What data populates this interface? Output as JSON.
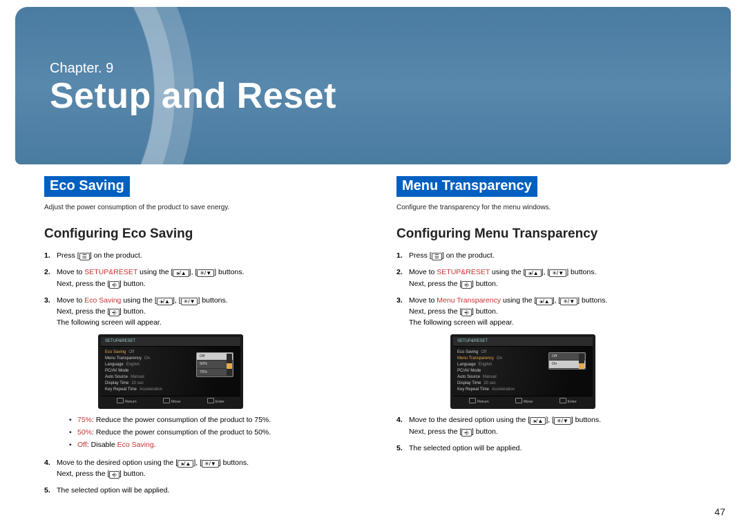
{
  "header": {
    "chapter_label": "Chapter. 9",
    "title": "Setup and Reset"
  },
  "page_number": "47",
  "icons": {
    "menu": "☰",
    "vol_up": "🕩/▲",
    "vol_dn": "✳/▼",
    "enter": "⎆"
  },
  "left": {
    "tag": "Eco Saving",
    "desc": "Adjust the power consumption of the product to save energy.",
    "subheading": "Configuring Eco Saving",
    "steps": {
      "s1_a": "Press [",
      "s1_b": "] on the product.",
      "s2_a": "Move to ",
      "s2_target": "SETUP&RESET",
      "s2_b": " using the [",
      "s2_c": "], [",
      "s2_d": "] buttons.",
      "s2_next_a": "Next, press the [",
      "s2_next_b": "] button.",
      "s3_a": "Move to ",
      "s3_target": "Eco Saving",
      "s3_b": " using the [",
      "s3_c": "], [",
      "s3_d": "] buttons.",
      "s3_next_a": "Next, press the [",
      "s3_next_b": "] button.",
      "s3_follow": "The following screen will appear.",
      "s4_a": "Move to the desired option using the [",
      "s4_b": "], [",
      "s4_c": "] buttons.",
      "s4_next_a": "Next, press the [",
      "s4_next_b": "] button.",
      "s5": "The selected option will be applied."
    },
    "bullets": {
      "b1_key": "75%",
      "b1_txt": ": Reduce the power consumption of the product to 75%.",
      "b2_key": "50%",
      "b2_txt": ": Reduce the power consumption of the product to 50%.",
      "b3_key": "Off",
      "b3_txt": ": Disable ",
      "b3_target": "Eco Saving",
      "b3_dot": "."
    },
    "osd": {
      "header": "SETUP&RESET",
      "items": [
        {
          "label": "Eco Saving",
          "val": "Off",
          "sel": true
        },
        {
          "label": "Menu Transparency",
          "val": "On",
          "sel": false
        },
        {
          "label": "Language",
          "val": "English",
          "sel": false
        },
        {
          "label": "PC/AV Mode",
          "val": "",
          "sel": false
        },
        {
          "label": "Auto Source",
          "val": "Manual",
          "sel": false
        },
        {
          "label": "Display Time",
          "val": "20 sec",
          "sel": false
        },
        {
          "label": "Key Repeat Time",
          "val": "Acceleration",
          "sel": false
        }
      ],
      "popup": [
        "Off",
        "50%",
        "75%"
      ],
      "popup_active": 0,
      "footer": [
        "Return",
        "Move",
        "Enter"
      ]
    }
  },
  "right": {
    "tag": "Menu Transparency",
    "desc": "Configure the transparency for the menu windows.",
    "subheading": "Configuring Menu Transparency",
    "steps": {
      "s1_a": "Press [",
      "s1_b": "] on the product.",
      "s2_a": "Move to ",
      "s2_target": "SETUP&RESET",
      "s2_b": " using the [",
      "s2_c": "], [",
      "s2_d": "] buttons.",
      "s2_next_a": "Next, press the [",
      "s2_next_b": "] button.",
      "s3_a": "Move to ",
      "s3_target": "Menu Transparency",
      "s3_b": " using the [",
      "s3_c": "], [",
      "s3_d": "] buttons.",
      "s3_next_a": "Next, press the [",
      "s3_next_b": "] button.",
      "s3_follow": "The following screen will appear.",
      "s4_a": "Move to the desired option using the [",
      "s4_b": "], [",
      "s4_c": "] buttons.",
      "s4_next_a": "Next, press the [",
      "s4_next_b": "] button.",
      "s5": "The selected option will be applied."
    },
    "osd": {
      "header": "SETUP&RESET",
      "items": [
        {
          "label": "Eco Saving",
          "val": "Off",
          "sel": false
        },
        {
          "label": "Menu Transparency",
          "val": "On",
          "sel": true
        },
        {
          "label": "Language",
          "val": "English",
          "sel": false
        },
        {
          "label": "PC/AV Mode",
          "val": "",
          "sel": false
        },
        {
          "label": "Auto Source",
          "val": "Manual",
          "sel": false
        },
        {
          "label": "Display Time",
          "val": "20 sec",
          "sel": false
        },
        {
          "label": "Key Repeat Time",
          "val": "Acceleration",
          "sel": false
        }
      ],
      "popup": [
        "Off",
        "On"
      ],
      "popup_active": 1,
      "footer": [
        "Return",
        "Move",
        "Enter"
      ]
    }
  }
}
